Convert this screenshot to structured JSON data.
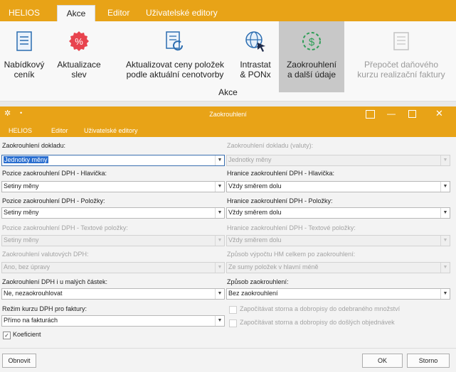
{
  "ribbon": {
    "tabs": [
      "HELIOS",
      "Akce",
      "Editor",
      "Uživatelské editory"
    ],
    "buttons": [
      {
        "l1": "Nabídkový",
        "l2": "ceník",
        "icon": "price-list-icon"
      },
      {
        "l1": "Aktualizace",
        "l2": "slev",
        "icon": "discount-icon"
      },
      {
        "l1": "Aktualizovat ceny položek",
        "l2": "podle aktuální cenotvorby",
        "icon": "refresh-document-icon"
      },
      {
        "l1": "Intrastat",
        "l2": "& PONx",
        "icon": "globe-cursor-icon"
      },
      {
        "l1": "Zaokrouhlení",
        "l2": "a další údaje",
        "icon": "rounding-money-icon"
      },
      {
        "l1": "Přepočet daňového",
        "l2": "kurzu realizační faktury",
        "icon": "recalc-icon"
      }
    ],
    "group_label": "Akce"
  },
  "dialog": {
    "title": "Zaokrouhlení",
    "menu": [
      "HELIOS",
      "Editor",
      "Uživatelské editory"
    ],
    "fields": {
      "zaokr_dokladu": {
        "label": "Zaokrouhlení dokladu:",
        "value": "Jednotky měny"
      },
      "zaokr_dokladu_valuty": {
        "label": "Zaokrouhlení dokladu (valuty):",
        "value": "Jednotky měny"
      },
      "pozice_hlav": {
        "label": "Pozice zaokrouhlení DPH - Hlavička:",
        "value": "Setiny měny"
      },
      "hranice_hlav": {
        "label": "Hranice zaokrouhlení DPH - Hlavička:",
        "value": "Vždy směrem dolu"
      },
      "pozice_pol": {
        "label": "Pozice zaokrouhlení DPH - Položky:",
        "value": "Setiny měny"
      },
      "hranice_pol": {
        "label": "Hranice zaokrouhlení DPH - Položky:",
        "value": "Vždy směrem dolu"
      },
      "pozice_text": {
        "label": "Pozice zaokrouhlení DPH - Textové položky:",
        "value": "Setiny měny"
      },
      "hranice_text": {
        "label": "Hranice zaokrouhlení DPH - Textové položky:",
        "value": "Vždy směrem dolu"
      },
      "zaokr_val": {
        "label": "Zaokrouhlení valutových DPH:",
        "value": "Ano, bez úpravy"
      },
      "zpusob_hm": {
        "label": "Způsob výpočtu HM celkem po zaokrouhlení:",
        "value": "Ze sumy položek v hlavní méně"
      },
      "zaokr_male": {
        "label": "Zaokrouhlení DPH i u malých částek:",
        "value": "Ne, nezaokrouhlovat"
      },
      "zpusob_zaokr": {
        "label": "Způsob zaokrouhlení:",
        "value": "Bez zaokrouhlení"
      },
      "rezim_kurzu": {
        "label": "Režim kurzu DPH pro faktury:",
        "value": "Přímo na fakturách"
      }
    },
    "checkboxes": {
      "storna_odebrane": {
        "label": "Započítávat storna a dobropisy do odebraného množství",
        "checked": false
      },
      "storna_dosle": {
        "label": "Započítávat storna a dobropisy do došlých objednávek",
        "checked": false
      },
      "koeficient": {
        "label": "Koeficient",
        "checked": true
      }
    },
    "buttons": {
      "obnovit": "Obnovit",
      "ok": "OK",
      "storno": "Storno"
    }
  },
  "colors": {
    "accent": "#e8a317",
    "selection": "#2a6ecf"
  }
}
